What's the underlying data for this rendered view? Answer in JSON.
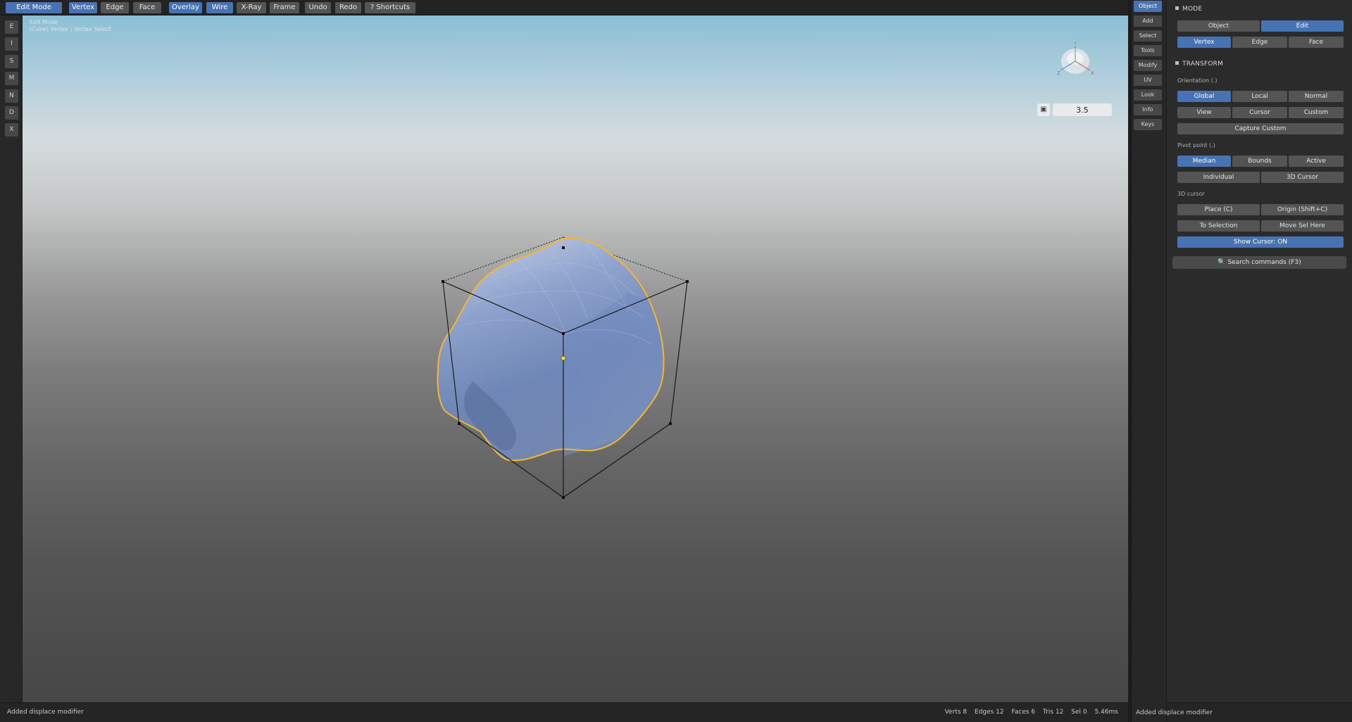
{
  "toolbar": {
    "edit_mode": "Edit Mode",
    "vertex": "Vertex",
    "edge": "Edge",
    "face": "Face",
    "overlay": "Overlay",
    "wire": "Wire",
    "xray": "X-Ray",
    "frame": "Frame",
    "undo": "Undo",
    "redo": "Redo",
    "shortcuts": "? Shortcuts"
  },
  "left_tools": [
    "E",
    "I",
    "S",
    "M",
    "N",
    "D",
    "X"
  ],
  "viewport": {
    "info_line1": "Edit Mode",
    "info_line2": "(Cube) Vertex | Vertex Select",
    "zoom_value": "3.5",
    "camera_icon": "camera-icon",
    "gizmo": {
      "x_label": "X",
      "y_label": "Y",
      "z_label": "Z"
    }
  },
  "status_bar": {
    "message": "Added displace modifier",
    "verts": "Verts 8",
    "edges": "Edges 12",
    "faces": "Faces 6",
    "tris": "Tris 12",
    "sel": "Sel 0",
    "time": "5.46ms"
  },
  "tabs": [
    "Object",
    "Add",
    "Select",
    "Tools",
    "Modify",
    "UV",
    "Look",
    "Info",
    "Keys"
  ],
  "active_tab": "Object",
  "panel": {
    "mode_title": "MODE",
    "object": "Object",
    "edit": "Edit",
    "vertex": "Vertex",
    "edge": "Edge",
    "face": "Face",
    "transform_title": "TRANSFORM",
    "orientation_label": "Orientation  (.)",
    "global": "Global",
    "local": "Local",
    "normal": "Normal",
    "view": "View",
    "cursor": "Cursor",
    "custom": "Custom",
    "capture_custom": "Capture Custom",
    "pivot_label": "Pivot point  (.)",
    "median": "Median",
    "bounds": "Bounds",
    "active": "Active",
    "individual": "Individual",
    "cursor3d": "3D Cursor",
    "cursor_label": "3D cursor",
    "place": "Place  (C)",
    "origin": "Origin  (Shift+C)",
    "to_selection": "To Selection",
    "move_sel_here": "Move Sel Here",
    "show_cursor": "Show Cursor: ON",
    "search": "Search commands  (F3)",
    "status": "Added displace modifier"
  },
  "colors": {
    "accent": "#4772b3",
    "selection_outline": "#f2b731",
    "mesh": "#7e95c0"
  }
}
